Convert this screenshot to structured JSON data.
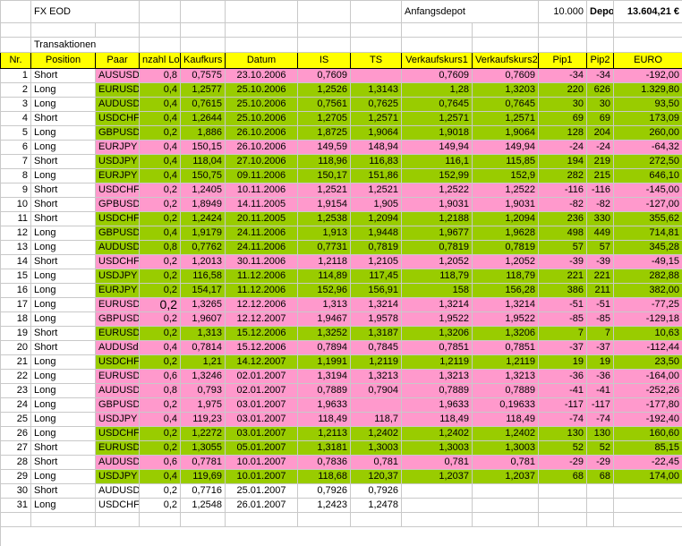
{
  "top": {
    "title": "FX EOD",
    "anfangsdepot_label": "Anfangsdepot",
    "anfangsdepot_value": "10.000",
    "depot_label": "Depot",
    "depot_value": "13.604,21 €"
  },
  "section_label": "Transaktionen",
  "headers": [
    "Nr.",
    "Position",
    "Paar",
    "nzahl Lo",
    "Kaufkurs",
    "Datum",
    "IS",
    "TS",
    "Verkaufskurs1",
    "Verkaufskurs2",
    "Pip1",
    "Pip2",
    "EURO"
  ],
  "colors": {
    "pink": "#ff99cc",
    "green": "#99cc00",
    "header": "#ffff00"
  },
  "rows": [
    {
      "nr": "1",
      "pos": "Short",
      "pair": "AUSUSD",
      "lots": "0,8",
      "kauf": "0,7575",
      "datum": "23.10.2006",
      "is": "0,7609",
      "ts": "",
      "vk1": "0,7609",
      "vk2": "0,7609",
      "pip1": "-34",
      "pip2": "-34",
      "euro": "-192,00",
      "color": "pink"
    },
    {
      "nr": "2",
      "pos": "Long",
      "pair": "EURUSD",
      "lots": "0,4",
      "kauf": "1,2577",
      "datum": "25.10.2006",
      "is": "1,2526",
      "ts": "1,3143",
      "vk1": "1,28",
      "vk2": "1,3203",
      "pip1": "220",
      "pip2": "626",
      "euro": "1.329,80",
      "color": "green"
    },
    {
      "nr": "3",
      "pos": "Long",
      "pair": "AUDUSD",
      "lots": "0,4",
      "kauf": "0,7615",
      "datum": "25.10.2006",
      "is": "0,7561",
      "ts": "0,7625",
      "vk1": "0,7645",
      "vk2": "0,7645",
      "pip1": "30",
      "pip2": "30",
      "euro": "93,50",
      "color": "green"
    },
    {
      "nr": "4",
      "pos": "Short",
      "pair": "USDCHF",
      "lots": "0,4",
      "kauf": "1,2644",
      "datum": "25.10.2006",
      "is": "1,2705",
      "ts": "1,2571",
      "vk1": "1,2571",
      "vk2": "1,2571",
      "pip1": "69",
      "pip2": "69",
      "euro": "173,09",
      "color": "green"
    },
    {
      "nr": "5",
      "pos": "Long",
      "pair": "GBPUSD",
      "lots": "0,2",
      "kauf": "1,886",
      "datum": "26.10.2006",
      "is": "1,8725",
      "ts": "1,9064",
      "vk1": "1,9018",
      "vk2": "1,9064",
      "pip1": "128",
      "pip2": "204",
      "euro": "260,00",
      "color": "green"
    },
    {
      "nr": "6",
      "pos": "Long",
      "pair": "EURJPY",
      "lots": "0,4",
      "kauf": "150,15",
      "datum": "26.10.2006",
      "is": "149,59",
      "ts": "148,94",
      "vk1": "149,94",
      "vk2": "149,94",
      "pip1": "-24",
      "pip2": "-24",
      "euro": "-64,32",
      "color": "pink"
    },
    {
      "nr": "7",
      "pos": "Short",
      "pair": "USDJPY",
      "lots": "0,4",
      "kauf": "118,04",
      "datum": "27.10.2006",
      "is": "118,96",
      "ts": "116,83",
      "vk1": "116,1",
      "vk2": "115,85",
      "pip1": "194",
      "pip2": "219",
      "euro": "272,50",
      "color": "green"
    },
    {
      "nr": "8",
      "pos": "Long",
      "pair": "EURJPY",
      "lots": "0,4",
      "kauf": "150,75",
      "datum": "09.11.2006",
      "is": "150,17",
      "ts": "151,86",
      "vk1": "152,99",
      "vk2": "152,9",
      "pip1": "282",
      "pip2": "215",
      "euro": "646,10",
      "color": "green"
    },
    {
      "nr": "9",
      "pos": "Short",
      "pair": "USDCHF",
      "lots": "0,2",
      "kauf": "1,2405",
      "datum": "10.11.2006",
      "is": "1,2521",
      "ts": "1,2521",
      "vk1": "1,2522",
      "vk2": "1,2522",
      "pip1": "-116",
      "pip2": "-116",
      "euro": "-145,00",
      "color": "pink"
    },
    {
      "nr": "10",
      "pos": "Short",
      "pair": "GPBUSD",
      "lots": "0,2",
      "kauf": "1,8949",
      "datum": "14.11.2005",
      "is": "1,9154",
      "ts": "1,905",
      "vk1": "1,9031",
      "vk2": "1,9031",
      "pip1": "-82",
      "pip2": "-82",
      "euro": "-127,00",
      "color": "pink"
    },
    {
      "nr": "11",
      "pos": "Short",
      "pair": "USDCHF",
      "lots": "0,2",
      "kauf": "1,2424",
      "datum": "20.11.2005",
      "is": "1,2538",
      "ts": "1,2094",
      "vk1": "1,2188",
      "vk2": "1,2094",
      "pip1": "236",
      "pip2": "330",
      "euro": "355,62",
      "color": "green"
    },
    {
      "nr": "12",
      "pos": "Long",
      "pair": "GBPUSD",
      "lots": "0,4",
      "kauf": "1,9179",
      "datum": "24.11.2006",
      "is": "1,913",
      "ts": "1,9448",
      "vk1": "1,9677",
      "vk2": "1,9628",
      "pip1": "498",
      "pip2": "449",
      "euro": "714,81",
      "color": "green"
    },
    {
      "nr": "13",
      "pos": "Long",
      "pair": "AUDUSD",
      "lots": "0,8",
      "kauf": "0,7762",
      "datum": "24.11.2006",
      "is": "0,7731",
      "ts": "0,7819",
      "vk1": "0,7819",
      "vk2": "0,7819",
      "pip1": "57",
      "pip2": "57",
      "euro": "345,28",
      "color": "green"
    },
    {
      "nr": "14",
      "pos": "Short",
      "pair": "USDCHF",
      "lots": "0,2",
      "kauf": "1,2013",
      "datum": "30.11.2006",
      "is": "1,2118",
      "ts": "1,2105",
      "vk1": "1,2052",
      "vk2": "1,2052",
      "pip1": "-39",
      "pip2": "-39",
      "euro": "-49,15",
      "color": "pink"
    },
    {
      "nr": "15",
      "pos": "Long",
      "pair": "USDJPY",
      "lots": "0,2",
      "kauf": "116,58",
      "datum": "11.12.2006",
      "is": "114,89",
      "ts": "117,45",
      "vk1": "118,79",
      "vk2": "118,79",
      "pip1": "221",
      "pip2": "221",
      "euro": "282,88",
      "color": "green"
    },
    {
      "nr": "16",
      "pos": "Long",
      "pair": "EURJPY",
      "lots": "0,2",
      "kauf": "154,17",
      "datum": "11.12.2006",
      "is": "152,96",
      "ts": "156,91",
      "vk1": "158",
      "vk2": "156,28",
      "pip1": "386",
      "pip2": "211",
      "euro": "382,00",
      "color": "green"
    },
    {
      "nr": "17",
      "pos": "Long",
      "pair": "EURUSD",
      "lots": "0,2",
      "kauf": "1,3265",
      "datum": "12.12.2006",
      "is": "1,313",
      "ts": "1,3214",
      "vk1": "1,3214",
      "vk2": "1,3214",
      "pip1": "-51",
      "pip2": "-51",
      "euro": "-77,25",
      "color": "pink",
      "bigLots": true
    },
    {
      "nr": "18",
      "pos": "Long",
      "pair": "GBPUSD",
      "lots": "0,2",
      "kauf": "1,9607",
      "datum": "12.12.2007",
      "is": "1,9467",
      "ts": "1,9578",
      "vk1": "1,9522",
      "vk2": "1,9522",
      "pip1": "-85",
      "pip2": "-85",
      "euro": "-129,18",
      "color": "pink"
    },
    {
      "nr": "19",
      "pos": "Short",
      "pair": "EURUSD",
      "lots": "0,2",
      "kauf": "1,313",
      "datum": "15.12.2006",
      "is": "1,3252",
      "ts": "1,3187",
      "vk1": "1,3206",
      "vk2": "1,3206",
      "pip1": "7",
      "pip2": "7",
      "euro": "10,63",
      "color": "green"
    },
    {
      "nr": "20",
      "pos": "Short",
      "pair": "AUDUSd",
      "lots": "0,4",
      "kauf": "0,7814",
      "datum": "15.12.2006",
      "is": "0,7894",
      "ts": "0,7845",
      "vk1": "0,7851",
      "vk2": "0,7851",
      "pip1": "-37",
      "pip2": "-37",
      "euro": "-112,44",
      "color": "pink"
    },
    {
      "nr": "21",
      "pos": "Long",
      "pair": "USDCHF",
      "lots": "0,2",
      "kauf": "1,21",
      "datum": "14.12.2007",
      "is": "1,1991",
      "ts": "1,2119",
      "vk1": "1,2119",
      "vk2": "1,2119",
      "pip1": "19",
      "pip2": "19",
      "euro": "23,50",
      "color": "green"
    },
    {
      "nr": "22",
      "pos": "Long",
      "pair": "EURUSD",
      "lots": "0,6",
      "kauf": "1,3246",
      "datum": "02.01.2007",
      "is": "1,3194",
      "ts": "1,3213",
      "vk1": "1,3213",
      "vk2": "1,3213",
      "pip1": "-36",
      "pip2": "-36",
      "euro": "-164,00",
      "color": "pink"
    },
    {
      "nr": "23",
      "pos": "Long",
      "pair": "AUDUSD",
      "lots": "0,8",
      "kauf": "0,793",
      "datum": "02.01.2007",
      "is": "0,7889",
      "ts": "0,7904",
      "vk1": "0,7889",
      "vk2": "0,7889",
      "pip1": "-41",
      "pip2": "-41",
      "euro": "-252,26",
      "color": "pink"
    },
    {
      "nr": "24",
      "pos": "Long",
      "pair": "GBPUSD",
      "lots": "0,2",
      "kauf": "1,975",
      "datum": "03.01.2007",
      "is": "1,9633",
      "ts": "",
      "vk1": "1,9633",
      "vk2": "0,19633",
      "pip1": "-117",
      "pip2": "-117",
      "euro": "-177,80",
      "color": "pink"
    },
    {
      "nr": "25",
      "pos": "Long",
      "pair": "USDJPY",
      "lots": "0,4",
      "kauf": "119,23",
      "datum": "03.01.2007",
      "is": "118,49",
      "ts": "118,7",
      "vk1": "118,49",
      "vk2": "118,49",
      "pip1": "-74",
      "pip2": "-74",
      "euro": "-192,40",
      "color": "pink"
    },
    {
      "nr": "26",
      "pos": "Long",
      "pair": "USDCHF",
      "lots": "0,2",
      "kauf": "1,2272",
      "datum": "03.01.2007",
      "is": "1,2113",
      "ts": "1,2402",
      "vk1": "1,2402",
      "vk2": "1,2402",
      "pip1": "130",
      "pip2": "130",
      "euro": "160,60",
      "color": "green"
    },
    {
      "nr": "27",
      "pos": "Short",
      "pair": "EURUSD",
      "lots": "0,2",
      "kauf": "1,3055",
      "datum": "05.01.2007",
      "is": "1,3181",
      "ts": "1,3003",
      "vk1": "1,3003",
      "vk2": "1,3003",
      "pip1": "52",
      "pip2": "52",
      "euro": "85,15",
      "color": "green"
    },
    {
      "nr": "28",
      "pos": "Short",
      "pair": "AUDUSD",
      "lots": "0,6",
      "kauf": "0,7781",
      "datum": "10.01.2007",
      "is": "0,7836",
      "ts": "0,781",
      "vk1": "0,781",
      "vk2": "0,781",
      "pip1": "-29",
      "pip2": "-29",
      "euro": "-22,45",
      "color": "pink"
    },
    {
      "nr": "29",
      "pos": "Long",
      "pair": "USDJPY",
      "lots": "0,4",
      "kauf": "119,69",
      "datum": "10.01.2007",
      "is": "118,68",
      "ts": "120,37",
      "vk1": "1,2037",
      "vk2": "1,2037",
      "pip1": "68",
      "pip2": "68",
      "euro": "174,00",
      "color": "green"
    },
    {
      "nr": "30",
      "pos": "Short",
      "pair": "AUDUSD",
      "lots": "0,2",
      "kauf": "0,7716",
      "datum": "25.01.2007",
      "is": "0,7926",
      "ts": "0,7926",
      "vk1": "",
      "vk2": "",
      "pip1": "",
      "pip2": "",
      "euro": "",
      "color": "none"
    },
    {
      "nr": "31",
      "pos": "Long",
      "pair": "USDCHF",
      "lots": "0,2",
      "kauf": "1,2548",
      "datum": "26.01.2007",
      "is": "1,2423",
      "ts": "1,2478",
      "vk1": "",
      "vk2": "",
      "pip1": "",
      "pip2": "",
      "euro": "",
      "color": "none"
    }
  ]
}
